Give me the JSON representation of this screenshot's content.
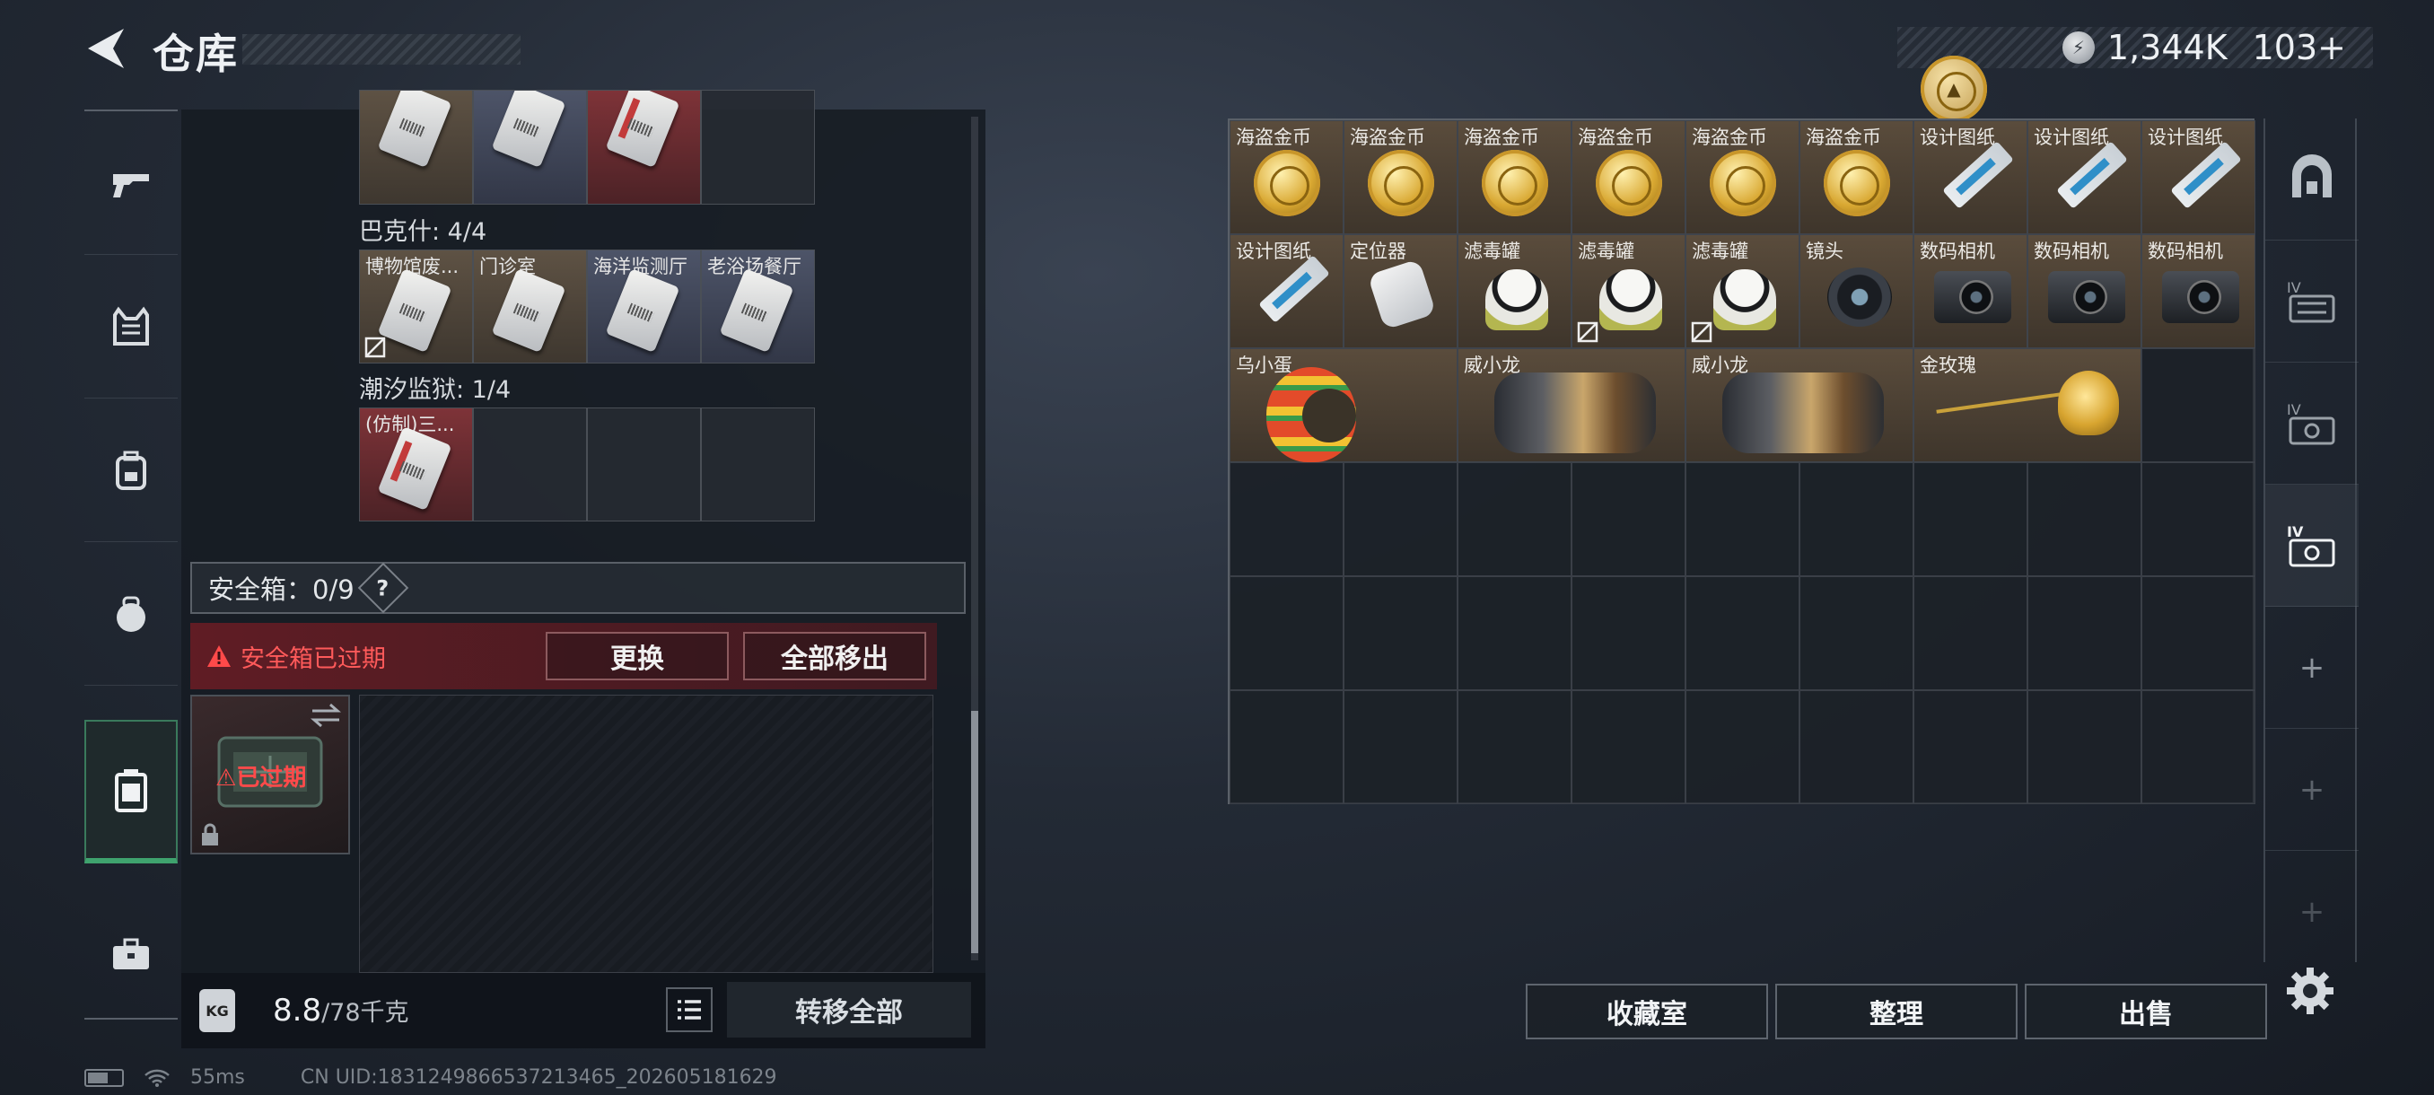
{
  "header": {
    "title": "仓库",
    "currency": [
      {
        "icon": "silver-coin-icon",
        "value": "1,344K"
      },
      {
        "icon": "gold-coin-icon",
        "value": "103+"
      }
    ]
  },
  "sidebar": {
    "items": [
      {
        "name": "weapon-tab",
        "icon": "gun-icon"
      },
      {
        "name": "armor-tab",
        "icon": "vest-icon"
      },
      {
        "name": "backpack-tab",
        "icon": "backpack-icon"
      },
      {
        "name": "helmet-tab",
        "icon": "gear-bag-icon"
      },
      {
        "name": "safe-case-tab",
        "icon": "container-icon",
        "selected": true
      },
      {
        "name": "toolbox-tab",
        "icon": "briefcase-icon"
      }
    ]
  },
  "left": {
    "section1_cells": [
      "",
      "",
      "",
      ""
    ],
    "section2_label": "巴克什: 4/4",
    "section2_cells": [
      "博物馆废...",
      "门诊室",
      "海洋监测厅",
      "老浴场餐厅"
    ],
    "section3_label": "潮汐监狱: 1/4",
    "section3_cells": [
      "(仿制)三...",
      "",
      "",
      ""
    ],
    "safe_label": "安全箱：0/9",
    "help": "?",
    "expired_notice": "安全箱已过期",
    "replace_btn": "更换",
    "move_all_btn": "全部移出",
    "case_status": "已过期",
    "weight_icon": "KG",
    "weight": "8.8",
    "weight_max": "/78千克",
    "transfer_all_btn": "转移全部"
  },
  "right": {
    "row1": [
      "海盗金币",
      "海盗金币",
      "海盗金币",
      "海盗金币",
      "海盗金币",
      "海盗金币",
      "设计图纸",
      "设计图纸",
      "设计图纸"
    ],
    "row2": [
      "设计图纸",
      "定位器",
      "滤毒罐",
      "滤毒罐",
      "滤毒罐",
      "镜头",
      "数码相机",
      "数码相机",
      "数码相机"
    ],
    "row3": [
      "乌小蛋",
      "威小龙",
      "威小龙",
      "金玫瑰"
    ],
    "tabs": [
      "main-stash-icon",
      "stash-IV-1-icon",
      "stash-IV-2-icon",
      "stash-IV-3-icon",
      "+",
      "+",
      "+"
    ],
    "collection_btn": "收藏室",
    "sort_btn": "整理",
    "sell_btn": "出售"
  },
  "status": {
    "ping": "55ms",
    "uid": "CN UID:18312498665372134​65_202605181629"
  }
}
